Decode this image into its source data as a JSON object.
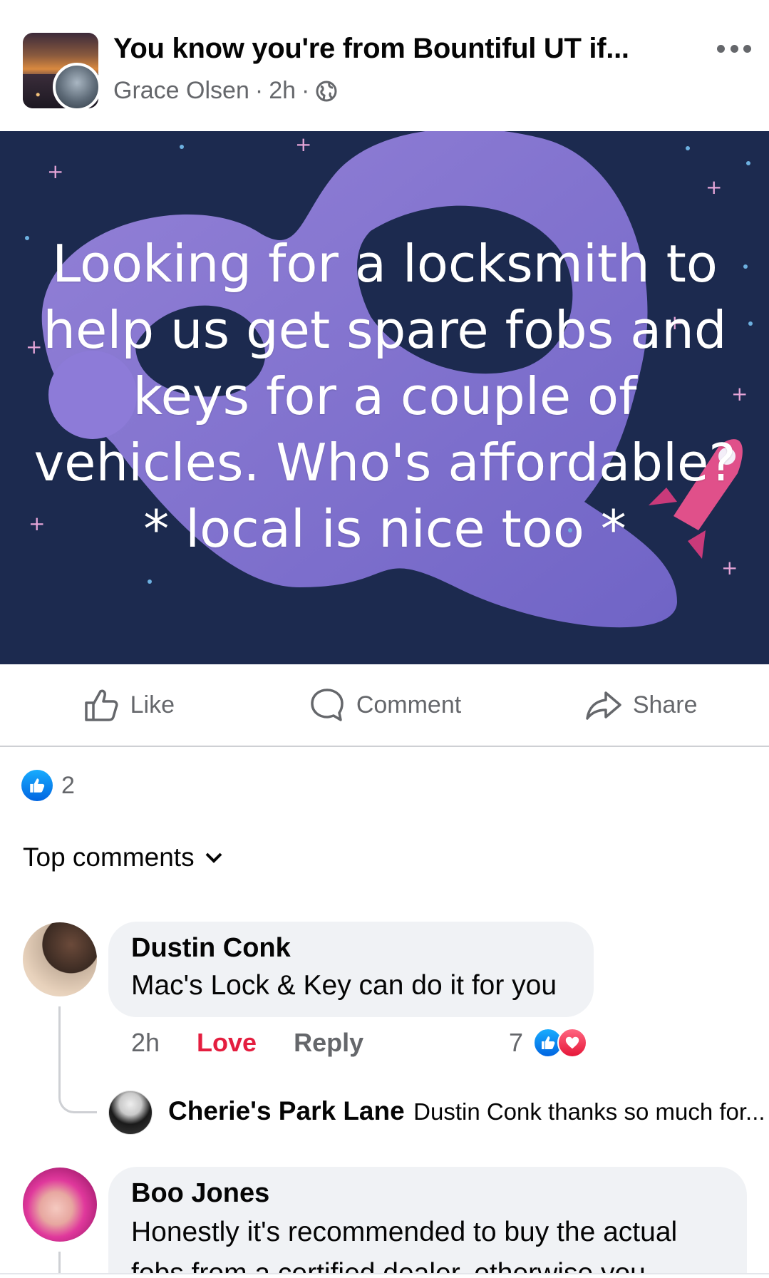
{
  "post": {
    "group_name": "You know you're from Bountiful UT if...",
    "author": "Grace Olsen",
    "time": "2h",
    "separator": "·",
    "privacy_icon": "globe-icon",
    "more_icon": "more-dots-icon",
    "background_text_lines": [
      "Looking for a locksmith to",
      "help us get spare fobs and",
      "keys for a couple of",
      "vehicles. Who's affordable?",
      "* local is nice too *"
    ],
    "background_colors": {
      "base": "#1c2a4f",
      "ribbon": "#8d7bd8",
      "rocket": "#e0508a"
    }
  },
  "actions": {
    "like_label": "Like",
    "comment_label": "Comment",
    "share_label": "Share"
  },
  "reactions": {
    "count": "2",
    "icon": "like-reaction-icon"
  },
  "comments_section": {
    "sort_label": "Top comments"
  },
  "comments": [
    {
      "name": "Dustin Conk",
      "text": "Mac's Lock & Key can do it for you",
      "time": "2h",
      "reaction_label": "Love",
      "reply_label": "Reply",
      "reaction_count": "7",
      "reaction_color": "#e41e3f"
    },
    {
      "name": "Cherie's Park Lane",
      "text": "Dustin Conk thanks so much for..."
    },
    {
      "name": "Boo Jones",
      "text_line1": "Honestly it's recommended to buy the actual",
      "text_line2": "fobs from a certified dealer, otherwise you"
    }
  ]
}
